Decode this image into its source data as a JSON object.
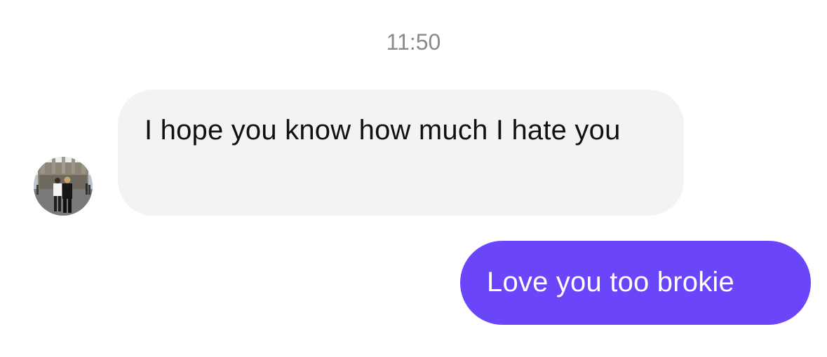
{
  "conversation": {
    "timestamp": "11:50",
    "messages": [
      {
        "direction": "incoming",
        "text": "I hope you know how much I hate you",
        "avatar_icon": "contact-photo-avatar"
      },
      {
        "direction": "outgoing",
        "text": "Love you too brokie"
      }
    ]
  },
  "colors": {
    "timestamp_text": "#8a8a8e",
    "incoming_bubble": "#f2f3f5",
    "incoming_text": "#111111",
    "outgoing_bubble": "#6b45f9",
    "outgoing_text": "#ffffff",
    "background": "#ffffff"
  }
}
